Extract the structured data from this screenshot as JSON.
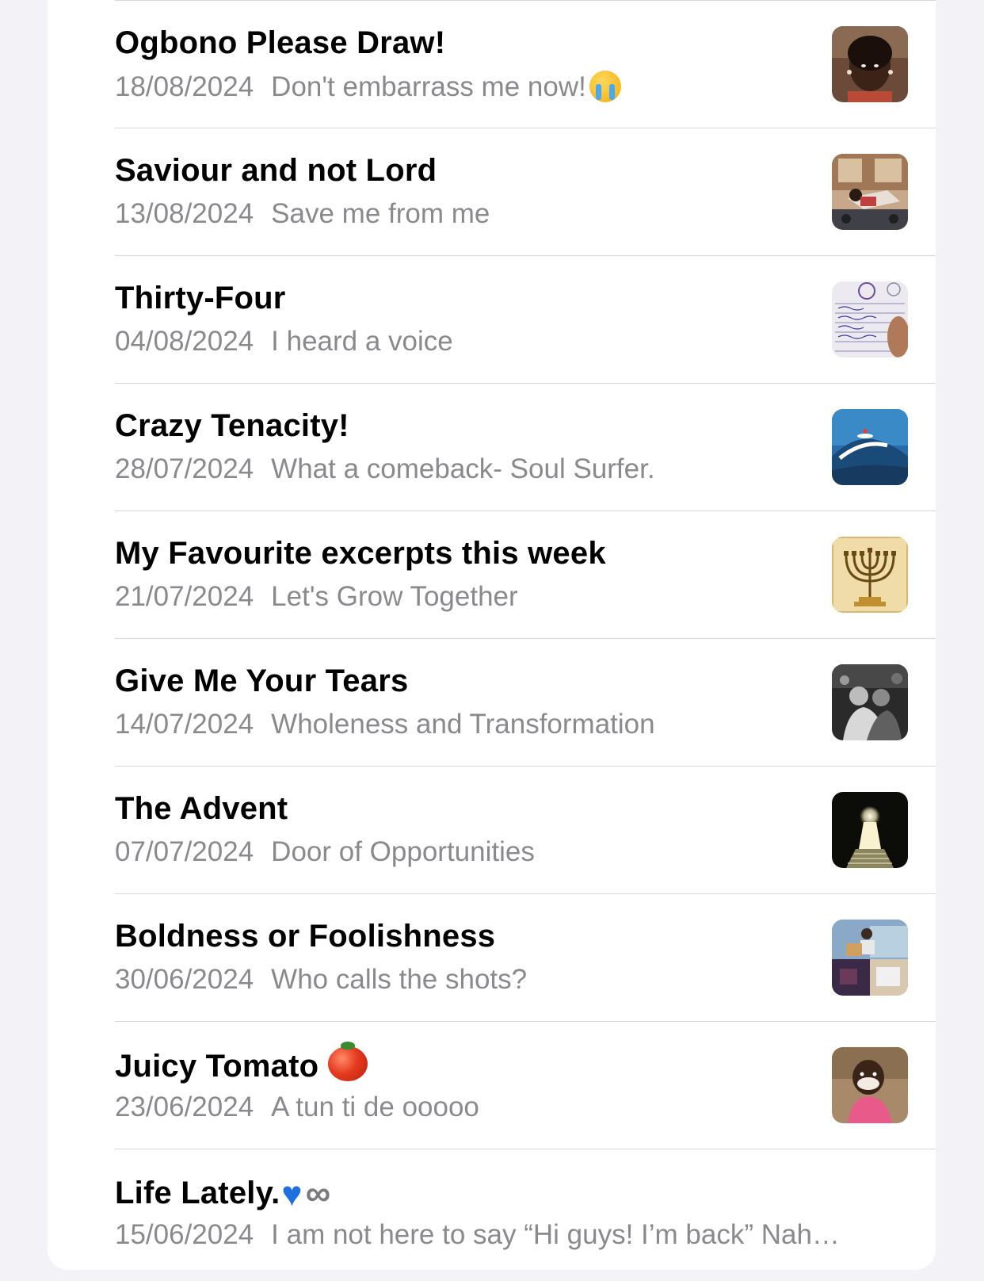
{
  "posts": [
    {
      "title": "Ogbono Please Draw!",
      "date": "18/08/2024",
      "subtitle": "Don't embarrass me now!",
      "subtitle_emoji": "loudly-crying-face",
      "thumbnail": "portrait-woman-photo"
    },
    {
      "title": "Saviour and not Lord",
      "date": "13/08/2024",
      "subtitle": "Save me from me",
      "thumbnail": "person-leaning-photo"
    },
    {
      "title": "Thirty-Four",
      "date": "04/08/2024",
      "subtitle": "I heard a voice",
      "thumbnail": "handwritten-note-photo"
    },
    {
      "title": "Crazy Tenacity!",
      "date": "28/07/2024",
      "subtitle": "What a comeback- Soul Surfer.",
      "thumbnail": "surfer-wave-photo"
    },
    {
      "title": "My Favourite excerpts this week",
      "date": "21/07/2024",
      "subtitle": "Let's Grow Together",
      "thumbnail": "menorah-illustration"
    },
    {
      "title": "Give Me Your Tears",
      "date": "14/07/2024",
      "subtitle": "Wholeness and Transformation",
      "thumbnail": "embrace-bw-photo"
    },
    {
      "title": "The Advent",
      "date": "07/07/2024",
      "subtitle": "Door of Opportunities",
      "thumbnail": "keyhole-light-photo"
    },
    {
      "title": "Boldness or Foolishness",
      "date": "30/06/2024",
      "subtitle": "Who calls the shots?",
      "thumbnail": "collage-photo"
    },
    {
      "title": "Juicy Tomato",
      "title_emoji": "tomato",
      "date": "23/06/2024",
      "subtitle": "A tun ti de ooooo",
      "thumbnail": "smiling-child-photo"
    },
    {
      "title": "Life Lately.",
      "title_emojis": [
        "blue-heart",
        "infinity"
      ],
      "date": "15/06/2024",
      "subtitle": "I am not here to say “Hi guys! I’m back” Nah…",
      "thumbnail": "none"
    }
  ],
  "colors": {
    "background": "#f2f2f7",
    "card": "#ffffff",
    "title": "#000000",
    "subtitle": "#8a8a8e",
    "separator": "#d6d6da"
  }
}
